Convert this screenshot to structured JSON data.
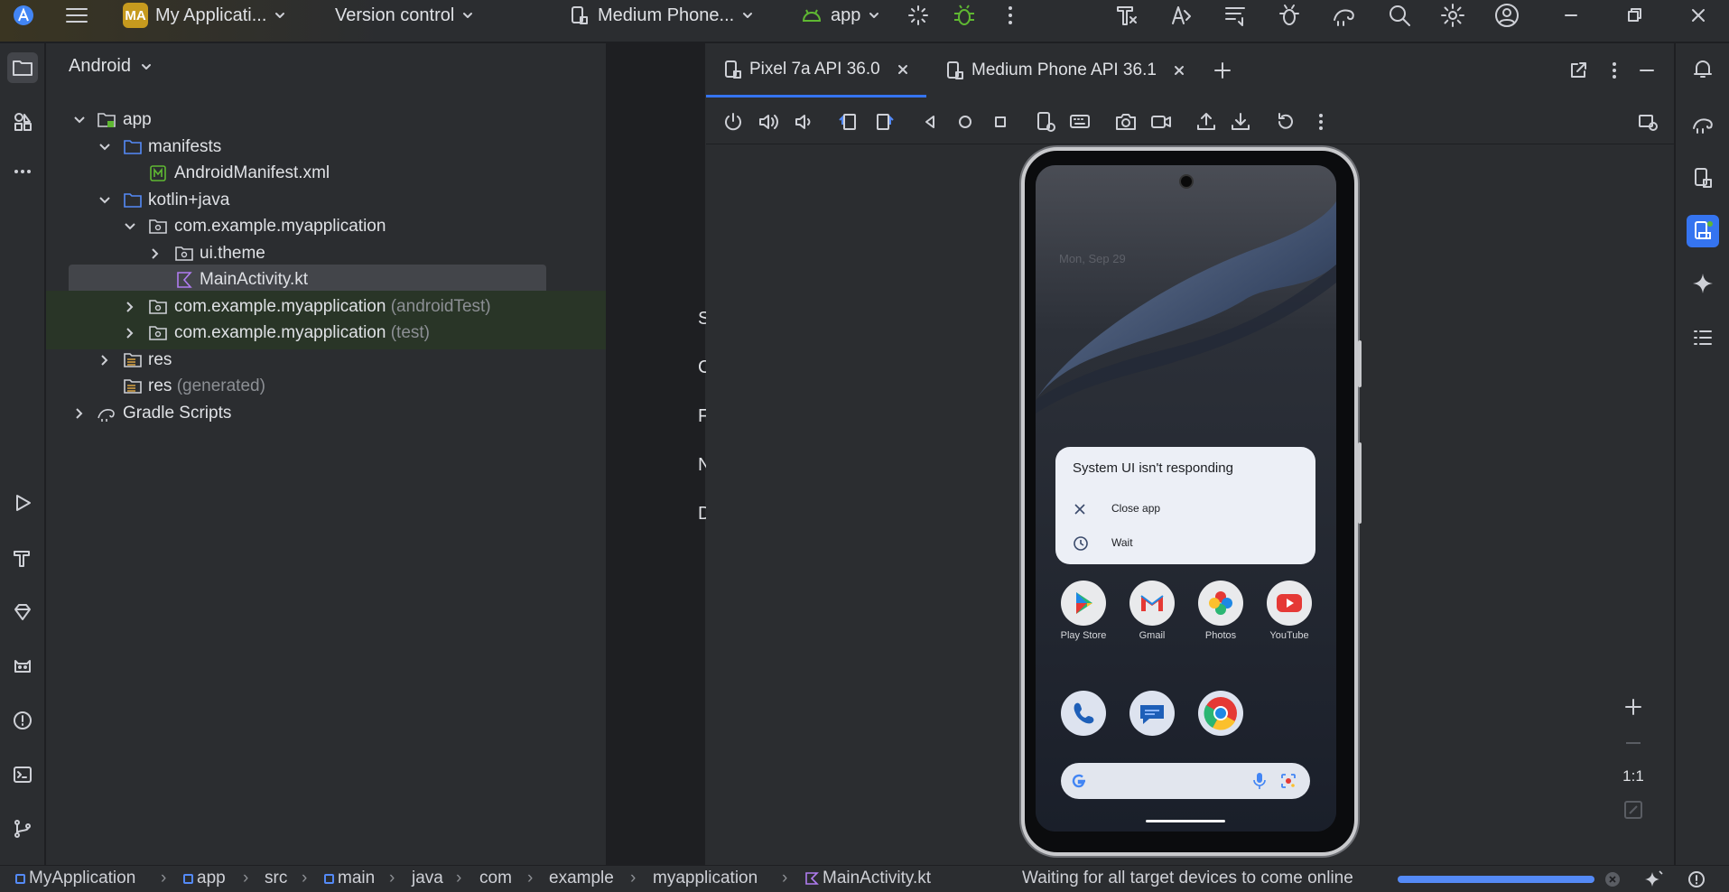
{
  "titlebar": {
    "project_badge": "MA",
    "project_name": "My Applicati...",
    "vcs": "Version control",
    "device": "Medium Phone...",
    "run_config": "app"
  },
  "project_panel": {
    "view_selector": "Android",
    "tree": [
      {
        "label": "app",
        "suffix": ""
      },
      {
        "label": "manifests",
        "suffix": ""
      },
      {
        "label": "AndroidManifest.xml",
        "suffix": ""
      },
      {
        "label": "kotlin+java",
        "suffix": ""
      },
      {
        "label": "com.example.myapplication",
        "suffix": ""
      },
      {
        "label": "ui.theme",
        "suffix": ""
      },
      {
        "label": "MainActivity.kt",
        "suffix": ""
      },
      {
        "label": "com.example.myapplication",
        "suffix": "(androidTest)"
      },
      {
        "label": "com.example.myapplication",
        "suffix": "(test)"
      },
      {
        "label": "res",
        "suffix": ""
      },
      {
        "label": "res",
        "suffix": "(generated)"
      },
      {
        "label": "Gradle Scripts",
        "suffix": ""
      }
    ]
  },
  "center_stripe_letters": [
    "S",
    "C",
    "F",
    "N",
    "D"
  ],
  "emulator": {
    "tabs": [
      {
        "label": "Pixel 7a API 36.0",
        "active": true
      },
      {
        "label": "Medium Phone API 36.1",
        "active": false
      }
    ],
    "zoom_label": "1:1",
    "phone": {
      "date": "Mon, Sep 29",
      "dialog": {
        "title": "System UI isn't responding",
        "close_label": "Close app",
        "wait_label": "Wait"
      },
      "apps": [
        "Play Store",
        "Gmail",
        "Photos",
        "YouTube"
      ]
    }
  },
  "statusbar": {
    "breadcrumbs": [
      "MyApplication",
      "app",
      "src",
      "main",
      "java",
      "com",
      "example",
      "myapplication",
      "MainActivity.kt"
    ],
    "message": "Waiting for all target devices to come online",
    "progress": 1.0
  },
  "colors": {
    "accent": "#3574f0",
    "green_rows": "#293527",
    "selected_row": "#43454a",
    "android_green": "#5fb832"
  }
}
